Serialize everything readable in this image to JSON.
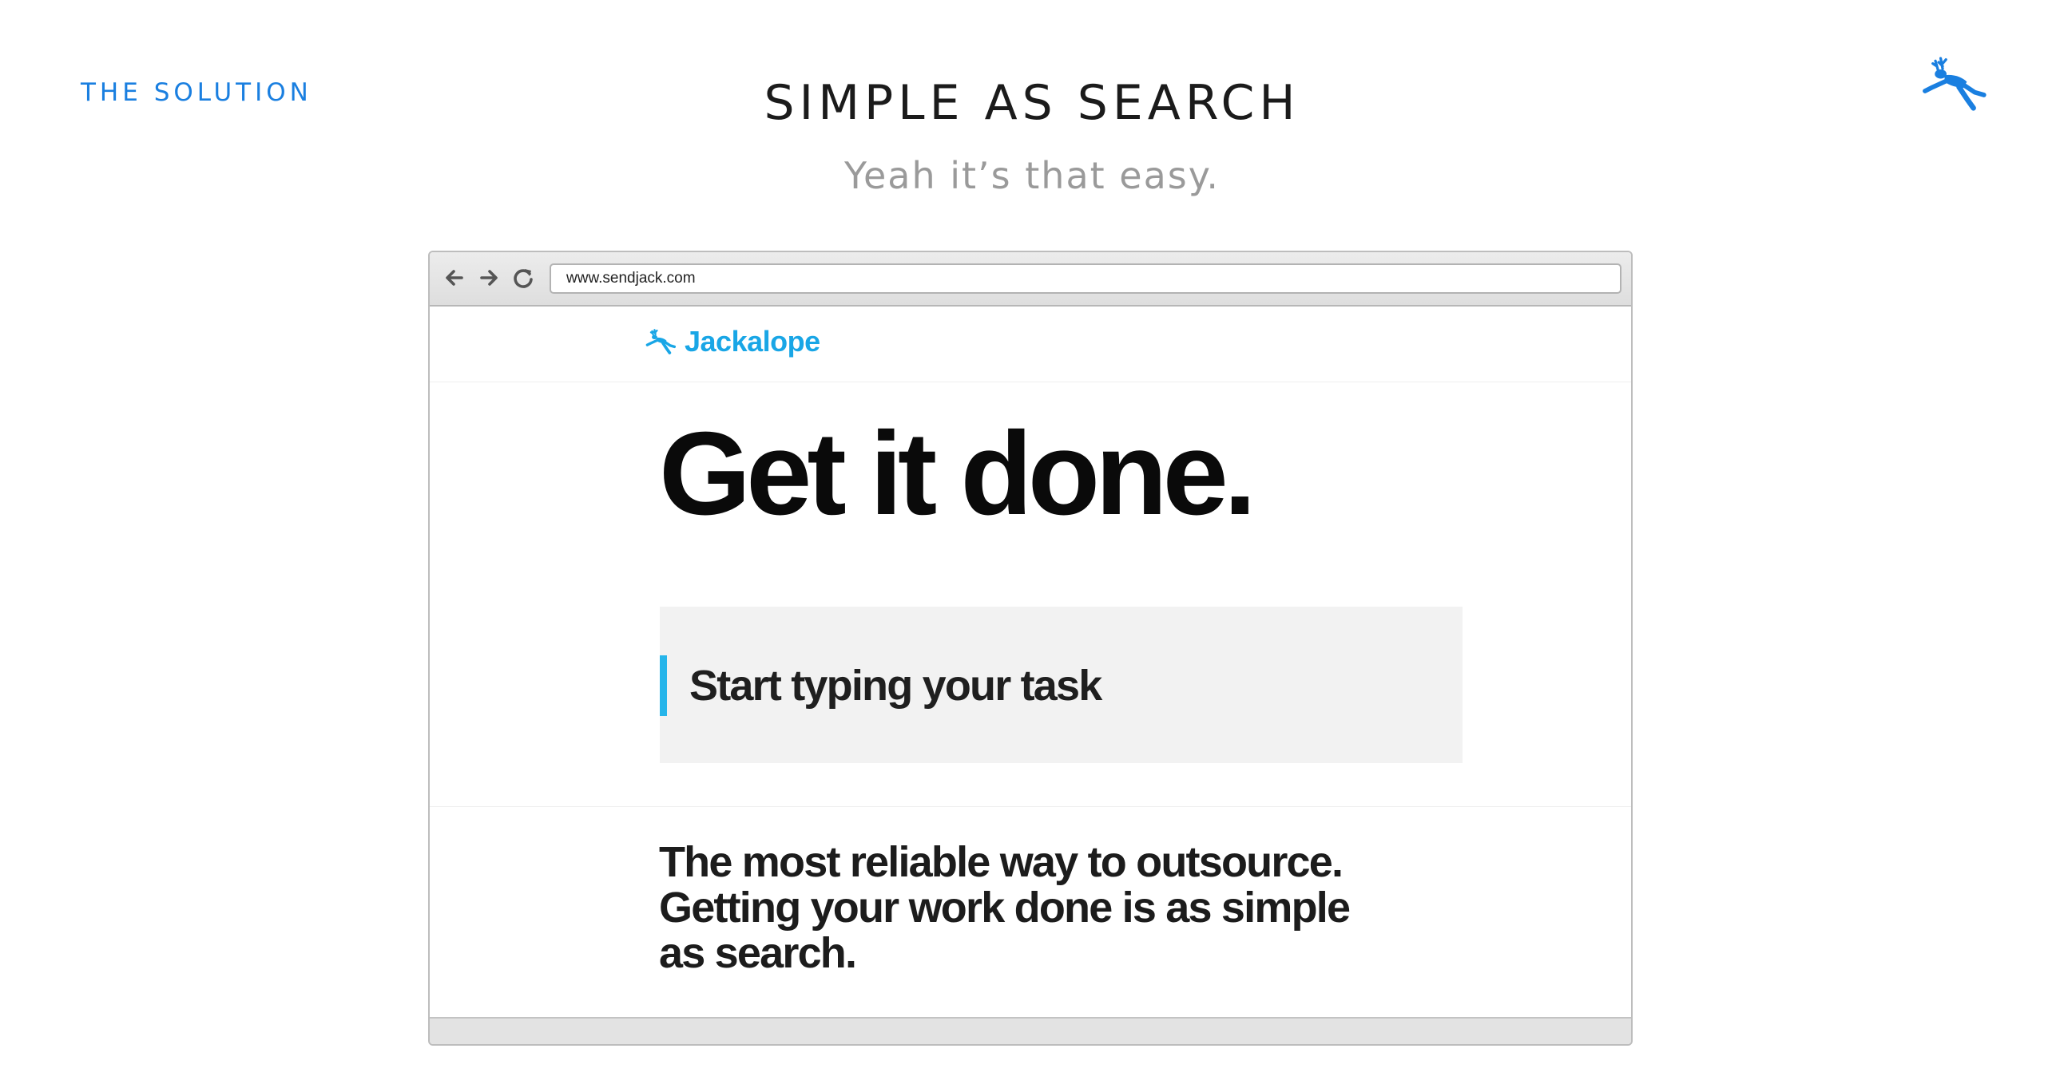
{
  "slide": {
    "section_label": "THE SOLUTION",
    "title": "SIMPLE AS SEARCH",
    "subtitle": "Yeah it’s that easy.",
    "accent_color": "#1a7fe0",
    "logo_icon": "jackalope-icon"
  },
  "browser": {
    "url": "www.sendjack.com",
    "nav_icons": [
      "back-arrow-icon",
      "forward-arrow-icon",
      "reload-icon"
    ]
  },
  "site": {
    "brand_name": "Jackalope",
    "brand_color": "#19a6e6",
    "headline": "Get it done.",
    "task_input": {
      "placeholder": "Start typing your task",
      "cursor_color": "#26b5ea"
    },
    "tagline_lines": [
      "The most reliable way to outsource.",
      "Getting your work done is as simple",
      "as search."
    ]
  }
}
